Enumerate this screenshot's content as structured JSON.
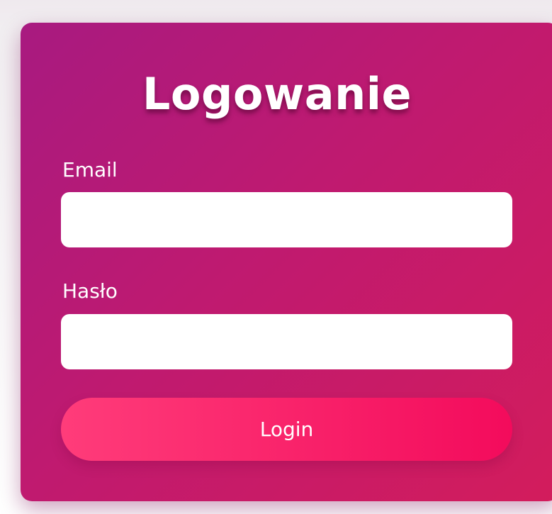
{
  "login_form": {
    "title": "Logowanie",
    "email_label": "Email",
    "email_value": "",
    "password_label": "Hasło",
    "password_value": "",
    "submit_label": "Login"
  },
  "colors": {
    "card_gradient_start": "#a81a80",
    "card_gradient_end": "#d31c5c",
    "button_gradient_start": "#ff3c7a",
    "button_gradient_end": "#f30b5c",
    "text": "#ffffff",
    "field_background": "#ffffff"
  }
}
